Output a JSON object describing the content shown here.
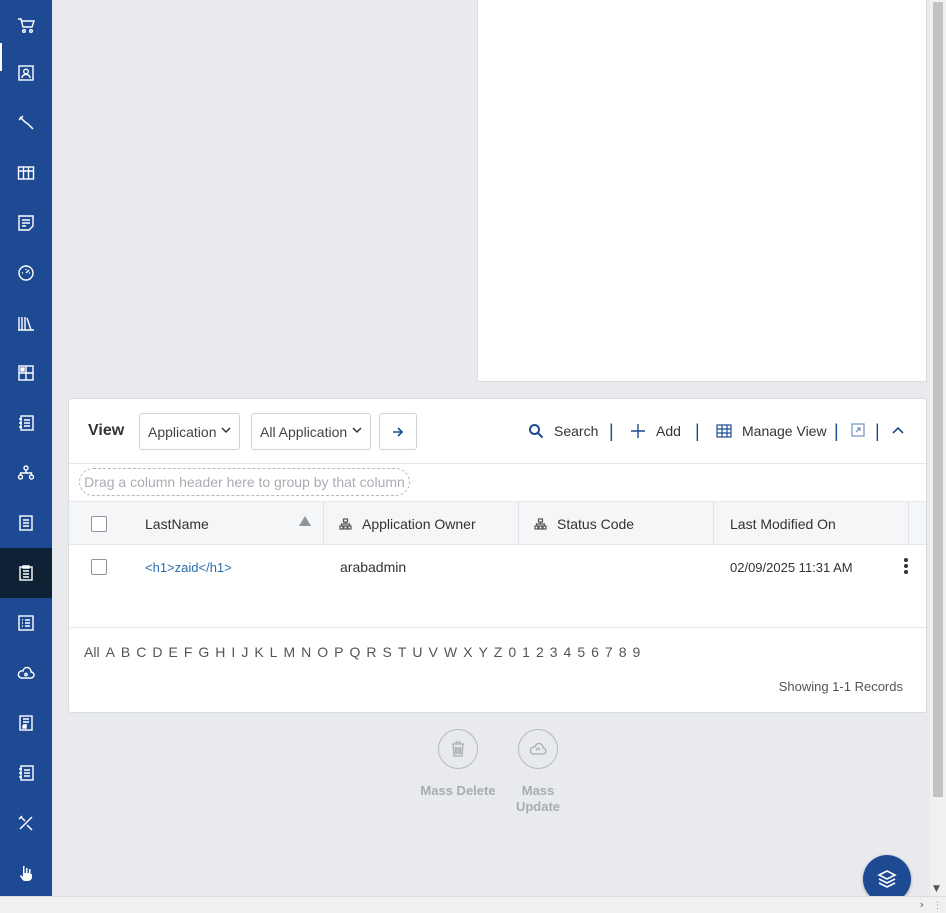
{
  "sidebar": {
    "items": [
      {
        "icon": "cart-icon"
      },
      {
        "icon": "contact-card-icon"
      },
      {
        "icon": "wrench-icon"
      },
      {
        "icon": "columns-icon"
      },
      {
        "icon": "notes-icon"
      },
      {
        "icon": "dashboard-gauge-icon"
      },
      {
        "icon": "library-icon"
      },
      {
        "icon": "layout-icon"
      },
      {
        "icon": "list-document-icon"
      },
      {
        "icon": "hierarchy-icon"
      },
      {
        "icon": "document-icon"
      },
      {
        "icon": "clipboard-icon",
        "active": true
      },
      {
        "icon": "checklist-icon"
      },
      {
        "icon": "cloud-eye-icon"
      },
      {
        "icon": "report-icon"
      },
      {
        "icon": "list-document-2-icon"
      },
      {
        "icon": "tools-icon"
      },
      {
        "icon": "hand-pointer-icon"
      }
    ]
  },
  "toolbar": {
    "view_label": "View",
    "view_select": "Application",
    "filter_select": "All Application",
    "search_label": "Search",
    "add_label": "Add",
    "manage_view_label": "Manage View",
    "separator": "|"
  },
  "grouping": {
    "placeholder": "Drag a column header here to group by that column"
  },
  "grid": {
    "columns": [
      "LastName",
      "Application Owner",
      "Status Code",
      "Last Modified On"
    ],
    "rows": [
      {
        "last_name": "<h1>zaid</h1>",
        "owner": "arabadmin",
        "status": "",
        "modified": "02/09/2025 11:31 AM"
      }
    ]
  },
  "alphabet": [
    "All",
    "A",
    "B",
    "C",
    "D",
    "E",
    "F",
    "G",
    "H",
    "I",
    "J",
    "K",
    "L",
    "M",
    "N",
    "O",
    "P",
    "Q",
    "R",
    "S",
    "T",
    "U",
    "V",
    "W",
    "X",
    "Y",
    "Z",
    "0",
    "1",
    "2",
    "3",
    "4",
    "5",
    "6",
    "7",
    "8",
    "9"
  ],
  "records_text": "Showing 1-1 Records",
  "mass_actions": {
    "delete_label": "Mass Delete",
    "update_label_1": "Mass",
    "update_label_2": "Update"
  },
  "colors": {
    "sidebar": "#1e4a93",
    "sidebar_active": "#0f2134",
    "link": "#2b6cb0"
  }
}
